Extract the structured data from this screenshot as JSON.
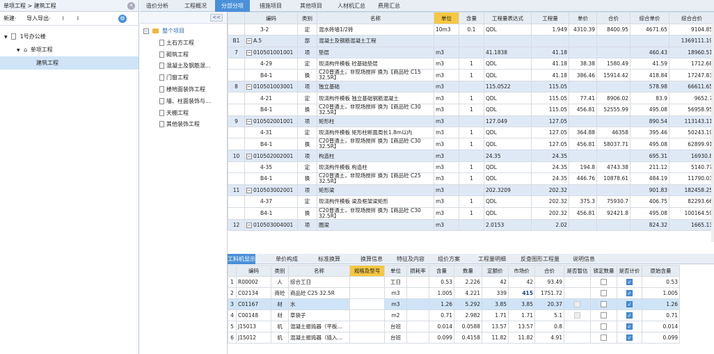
{
  "left": {
    "breadcrumb": "单项工程 > 建筑工程",
    "toolbar": {
      "new_label": "新建·",
      "import_label": "导入导出·",
      "up": "⬆",
      "down": "⬇"
    },
    "tree": [
      {
        "label": "1号办公楼",
        "level": 0,
        "expander": "▼"
      },
      {
        "label": "单项工程",
        "level": 1,
        "expander": "▼"
      },
      {
        "label": "建筑工程",
        "level": 2,
        "expander": ""
      }
    ]
  },
  "tabs": [
    "造价分析",
    "工程概况",
    "分部分项",
    "措施项目",
    "其他项目",
    "人材机汇总",
    "费用汇总"
  ],
  "active_tab": 2,
  "mid_tree": {
    "collapse": "<<",
    "root": "整个项目",
    "items": [
      "土石方工程",
      "砌筑工程",
      "混凝土及钢筋混...",
      "门窗工程",
      "楼地面装饰工程",
      "墙、柱面装饰与...",
      "天棚工程",
      "其他装饰工程"
    ]
  },
  "grid": {
    "headers": [
      "",
      "编码",
      "类别",
      "名称",
      "单位",
      "含量",
      "工程量表达式",
      "工程量",
      "单价",
      "合价",
      "综合单价",
      "综合合价"
    ],
    "rows": [
      {
        "type": "item",
        "no": "",
        "code": "3-2",
        "cat": "定",
        "name": "混水砖墙1/2砖",
        "unit": "10m3",
        "cont": "0.1",
        "expr": "QDL",
        "qty": "1.949",
        "price": "4310.39",
        "total": "8400.95",
        "uprice": "4671.65",
        "utotal": "9104.85"
      },
      {
        "type": "sec",
        "no": "B1",
        "code": "A.5",
        "cat": "部",
        "name": "混凝土及钢筋混凝土工程",
        "unit": "",
        "cont": "",
        "expr": "",
        "qty": "",
        "price": "",
        "total": "",
        "uprice": "",
        "utotal": "1369111.19"
      },
      {
        "type": "sec",
        "no": "7",
        "code": "010501001001",
        "cat": "项",
        "name": "垫层",
        "unit": "m3",
        "cont": "",
        "expr": "41.1838",
        "qty": "41.18",
        "price": "",
        "total": "",
        "uprice": "460.43",
        "utotal": "18960.51"
      },
      {
        "type": "item",
        "no": "",
        "code": "4-29",
        "cat": "定",
        "name": "现浇构件模板 砼基础垫层",
        "unit": "m3",
        "cont": "1",
        "expr": "QDL",
        "qty": "41.18",
        "price": "38.38",
        "total": "1580.49",
        "uprice": "41.59",
        "utotal": "1712.68"
      },
      {
        "type": "item2",
        "no": "",
        "code": "B4-1",
        "cat": "换",
        "name": "C20普通土，非现场搅拌 换为【商品砼 C15 32.5R】",
        "unit": "m3",
        "cont": "1",
        "expr": "QDL",
        "qty": "41.18",
        "price": "386.46",
        "total": "15914.42",
        "uprice": "418.84",
        "utotal": "17247.83"
      },
      {
        "type": "sec",
        "no": "8",
        "code": "010501003001",
        "cat": "项",
        "name": "独立基础",
        "unit": "m3",
        "cont": "",
        "expr": "115.0522",
        "qty": "115.05",
        "price": "",
        "total": "",
        "uprice": "578.98",
        "utotal": "66611.65"
      },
      {
        "type": "item",
        "no": "",
        "code": "4-21",
        "cat": "定",
        "name": "现浇构件模板 独立基础钢筋混凝土",
        "unit": "m3",
        "cont": "1",
        "expr": "QDL",
        "qty": "115.05",
        "price": "77.41",
        "total": "8906.02",
        "uprice": "83.9",
        "utotal": "9652.7"
      },
      {
        "type": "item2",
        "no": "",
        "code": "B4-1",
        "cat": "换",
        "name": "C20普通土，非现场搅拌 换为【商品砼 C30 32.5R】",
        "unit": "m3",
        "cont": "1",
        "expr": "QDL",
        "qty": "115.05",
        "price": "456.81",
        "total": "52555.99",
        "uprice": "495.08",
        "utotal": "56958.95"
      },
      {
        "type": "sec",
        "no": "9",
        "code": "010502001001",
        "cat": "项",
        "name": "矩形柱",
        "unit": "m3",
        "cont": "",
        "expr": "127.049",
        "qty": "127.05",
        "price": "",
        "total": "",
        "uprice": "890.54",
        "utotal": "113143.11"
      },
      {
        "type": "item",
        "no": "",
        "code": "4-31",
        "cat": "定",
        "name": "现浇构件模板 矩形柱断面周长1.8m以内",
        "unit": "m3",
        "cont": "1",
        "expr": "QDL",
        "qty": "127.05",
        "price": "364.88",
        "total": "46358",
        "uprice": "395.46",
        "utotal": "50243.19"
      },
      {
        "type": "item2",
        "no": "",
        "code": "B4-1",
        "cat": "换",
        "name": "C20普通土，非现场搅拌 换为【商品砼 C30 32.5R】",
        "unit": "m3",
        "cont": "1",
        "expr": "QDL",
        "qty": "127.05",
        "price": "456.81",
        "total": "58037.71",
        "uprice": "495.08",
        "utotal": "62899.91"
      },
      {
        "type": "sec",
        "no": "10",
        "code": "010502002001",
        "cat": "项",
        "name": "构造柱",
        "unit": "m3",
        "cont": "",
        "expr": "24.35",
        "qty": "24.35",
        "price": "",
        "total": "",
        "uprice": "695.31",
        "utotal": "16930.8"
      },
      {
        "type": "item",
        "no": "",
        "code": "4-35",
        "cat": "定",
        "name": "现浇构件模板 构造柱",
        "unit": "m3",
        "cont": "1",
        "expr": "QDL",
        "qty": "24.35",
        "price": "194.8",
        "total": "4743.38",
        "uprice": "211.12",
        "utotal": "5140.77"
      },
      {
        "type": "item2",
        "no": "",
        "code": "B4-1",
        "cat": "换",
        "name": "C20普通土，非现场搅拌 换为【商品砼 C25 32.5R】",
        "unit": "m3",
        "cont": "1",
        "expr": "QDL",
        "qty": "24.35",
        "price": "446.76",
        "total": "10878.61",
        "uprice": "484.19",
        "utotal": "11790.03"
      },
      {
        "type": "sec",
        "no": "11",
        "code": "010503002001",
        "cat": "项",
        "name": "矩形梁",
        "unit": "m3",
        "cont": "",
        "expr": "202.3209",
        "qty": "202.32",
        "price": "",
        "total": "",
        "uprice": "901.83",
        "utotal": "182458.25"
      },
      {
        "type": "item",
        "no": "",
        "code": "4-37",
        "cat": "定",
        "name": "现浇构件模板 梁及框架梁矩形",
        "unit": "m3",
        "cont": "1",
        "expr": "QDL",
        "qty": "202.32",
        "price": "375.3",
        "total": "75930.7",
        "uprice": "406.75",
        "utotal": "82293.66"
      },
      {
        "type": "item2",
        "no": "",
        "code": "B4-1",
        "cat": "换",
        "name": "C20普通土，非现场搅拌 换为【商品砼 C30 32.5R】",
        "unit": "m3",
        "cont": "1",
        "expr": "QDL",
        "qty": "202.32",
        "price": "456.81",
        "total": "92421.8",
        "uprice": "495.08",
        "utotal": "100164.59"
      },
      {
        "type": "sec",
        "no": "12",
        "code": "010503004001",
        "cat": "项",
        "name": "圈梁",
        "unit": "m3",
        "cont": "",
        "expr": "2.0153",
        "qty": "2.02",
        "price": "",
        "total": "",
        "uprice": "824.32",
        "utotal": "1665.13"
      }
    ]
  },
  "bottom_tabs": [
    "工料机显示",
    "单价构成",
    "标准换算",
    "换算信息",
    "特征及内容",
    "组价方案",
    "工程量明细",
    "反查图形工程量",
    "说明信息"
  ],
  "bottom_active": 0,
  "bottom_grid": {
    "headers": [
      "",
      "编码",
      "类别",
      "名称",
      "规格及型号",
      "单位",
      "损耗率",
      "含量",
      "数量",
      "定额价",
      "市场价",
      "合价",
      "是否暂估",
      "锁定数量",
      "是否计价",
      "原始含量"
    ],
    "rows": [
      {
        "no": "1",
        "code": "R00002",
        "cat": "人",
        "name": "综合工日",
        "spec": "",
        "unit": "工日",
        "loss": "",
        "cont": "0.53",
        "qty": "2.226",
        "dprice": "42",
        "mprice": "42",
        "total": "93.49",
        "est": "none",
        "lock": false,
        "calc": true,
        "orig": "0.53"
      },
      {
        "no": "2",
        "code": "C02134",
        "cat": "商砼",
        "name": "商品砼 C25 32.5R",
        "spec": "",
        "unit": "m3",
        "cont": "1.005",
        "loss": "",
        "qty": "4.221",
        "dprice": "339",
        "mprice": "415",
        "total": "1751.72",
        "est": "none",
        "lock": false,
        "calc": true,
        "orig": "1.005"
      },
      {
        "no": "3",
        "code": "C01167",
        "cat": "材",
        "name": "水",
        "spec": "",
        "unit": "m3",
        "cont": "1.26",
        "loss": "",
        "qty": "5.292",
        "dprice": "3.85",
        "mprice": "3.85",
        "total": "20.37",
        "est": "dis",
        "lock": false,
        "calc": true,
        "orig": "1.26"
      },
      {
        "no": "4",
        "code": "C00148",
        "cat": "材",
        "name": "草袋子",
        "spec": "",
        "unit": "m2",
        "cont": "0.71",
        "loss": "",
        "qty": "2.982",
        "dprice": "1.71",
        "mprice": "1.71",
        "total": "5.1",
        "est": "dis",
        "lock": false,
        "calc": true,
        "orig": "0.71"
      },
      {
        "no": "5",
        "code": "J15013",
        "cat": "机",
        "name": "混凝土振捣器（平板…",
        "spec": "",
        "unit": "台班",
        "cont": "0.014",
        "loss": "",
        "qty": "0.0588",
        "dprice": "13.57",
        "mprice": "13.57",
        "total": "0.8",
        "est": "none",
        "lock": false,
        "calc": true,
        "orig": "0.014"
      },
      {
        "no": "6",
        "code": "J15012",
        "cat": "机",
        "name": "混凝土振捣器（插入…",
        "spec": "",
        "unit": "台班",
        "cont": "0.099",
        "loss": "",
        "qty": "0.4158",
        "dprice": "11.82",
        "mprice": "11.82",
        "total": "4.91",
        "est": "none",
        "lock": false,
        "calc": true,
        "orig": "0.099"
      }
    ],
    "selected_row": 2
  },
  "colors": {
    "accent": "#4a90d9",
    "section_bg": "#dfe9f6",
    "header_hl": "#f5c842"
  }
}
